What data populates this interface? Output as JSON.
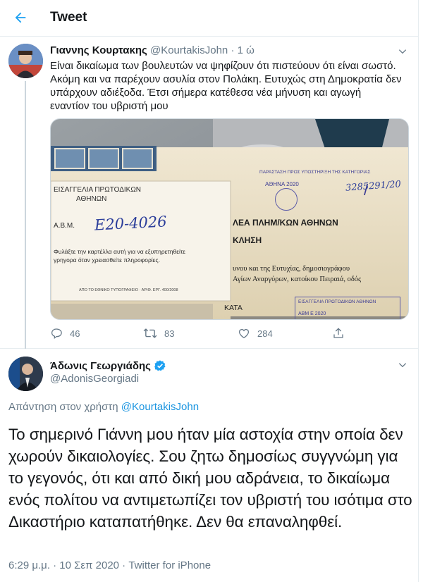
{
  "header": {
    "title": "Tweet",
    "back_icon": "arrow-left-icon"
  },
  "tweet1": {
    "author_name": "Γιαννης Κουρτακης",
    "handle": "@KourtakisJohn",
    "separator": "·",
    "time": "1 ώ",
    "text": "Είναι δικαίωμα των βουλευτών να ψηφίζουν ότι πιστεύουν ότι είναι σωστό. Ακόμη και να παρέχουν ασυλία στον Πολάκη. Ευτυχώς στη Δημοκρατία δεν υπάρχουν αδιέξοδα. Έτσι σήμερα κατέθεσα νέα μήνυση και αγωγή εναντίον του υβριστή μου",
    "media": {
      "card_title_1": "ΕΙΣΑΓΓΕΛΙΑ ΠΡΩΤΟΔΙΚΩΝ",
      "card_title_2": "ΑΘΗΝΩΝ",
      "card_ab": "Α.Β.Μ.",
      "card_number": "Ε20-4026",
      "card_note_1": "Φυλάξτε την καρτέλλα αυτή για να εξυπηρετηθείτε",
      "card_note_2": "γρηγορα όταν χρειασθείτε πληροφορίες.",
      "card_footer": "ΑΠΟ ΤΟ ΕΘΝΙΚΟ ΤΥΠΟΓΡΑΦΕΙΟ · ΑΡΙΘ. ΕΡΓ. 400/2008",
      "stamp_1": "ΠΑΡΑΣΤΑΣΗ ΠΡΟΣ ΥΠΟΣΤΗΡΙΞΗ ΤΗΣ ΚΑΤΗΓΟΡΙΑΣ",
      "stamp_date": "ΑΘΗΝΑ 2020",
      "stamp_number": "3285291/20",
      "doc_line_1": "ΛΕΑ ΠΛΗΜ/ΚΩΝ ΑΘΗΝΩΝ",
      "doc_line_2": "ΚΛΗΣΗ",
      "doc_line_3": "υνου και της Ευτυχίας, δημοσιογράφου",
      "doc_line_4": "Αγίων Αναργύρων, κατοίκου Πειραιά, οδός",
      "doc_line_5": "ΚΑΤΑ",
      "stamp_2": "ΕΙΣΑΓΓΕΛΙΑ ΠΡΩΤΟΔΙΚΩΝ ΑΘΗΝΩΝ",
      "stamp_2_sub": "ΑΒΜ Ε 2020"
    },
    "actions": {
      "replies": "46",
      "retweets": "83",
      "likes": "284"
    }
  },
  "tweet2": {
    "author_name": "Άδωνις Γεωργιάδης",
    "handle": "@AdonisGeorgiadi",
    "reply_prefix": "Απάντηση στον χρήστη",
    "reply_handle": "@KourtakisJohn",
    "text": "Το σημερινό Γιάννη μου ήταν μία αστοχία στην οποία δεν χωρούν δικαιολογίες. Σου ζητω δημοσίως συγγνώμη για το γεγονός, ότι και από δική μου αδράνεια, το δικαίωμα ενός πολίτου να αντιμετωπίζει τον υβριστή του ισότιμα στο Δικαστήριο καταπατήθηκε. Δεν θα επαναληφθεί.",
    "timestamp": "6:29 μ.μ. · 10 Σεπ 2020 · Twitter for iPhone"
  },
  "colors": {
    "accent": "#1da1f2",
    "text": "#14171a",
    "muted": "#657786",
    "border": "#e6ecf0",
    "verified": "#1da1f2"
  }
}
